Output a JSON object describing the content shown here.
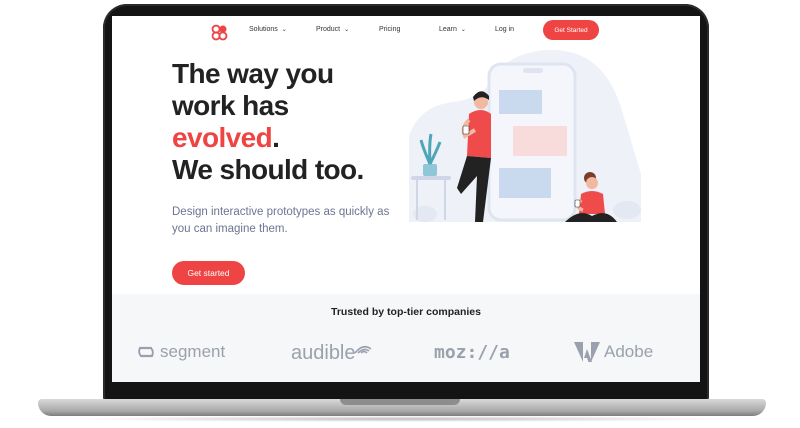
{
  "nav": {
    "items": [
      {
        "label": "Solutions",
        "has_dropdown": true
      },
      {
        "label": "Product",
        "has_dropdown": true
      },
      {
        "label": "Pricing",
        "has_dropdown": false
      },
      {
        "label": "Learn",
        "has_dropdown": true
      }
    ],
    "login_label": "Log in",
    "cta_label": "Get Started",
    "chevron": "chevron-down-icon"
  },
  "hero": {
    "line1": "The way you",
    "line2": "work has",
    "accent_word": "evolved",
    "line3_suffix": ".",
    "line4": "We should too.",
    "subtitle": "Design interactive prototypes as quickly as you can imagine them.",
    "button_label": "Get started"
  },
  "trusted": {
    "title": "Trusted by top-tier companies",
    "brands": [
      {
        "name": "segment",
        "icon": "segment-logo"
      },
      {
        "name": "audible",
        "icon": "audible-logo"
      },
      {
        "name": "moz://a",
        "icon": "mozilla-logo"
      },
      {
        "name": "Adobe",
        "icon": "adobe-logo"
      }
    ]
  },
  "colors": {
    "accent": "#ef4444",
    "text_dark": "#222222",
    "text_muted": "#6b7590",
    "band_bg": "#f6f7f9"
  }
}
